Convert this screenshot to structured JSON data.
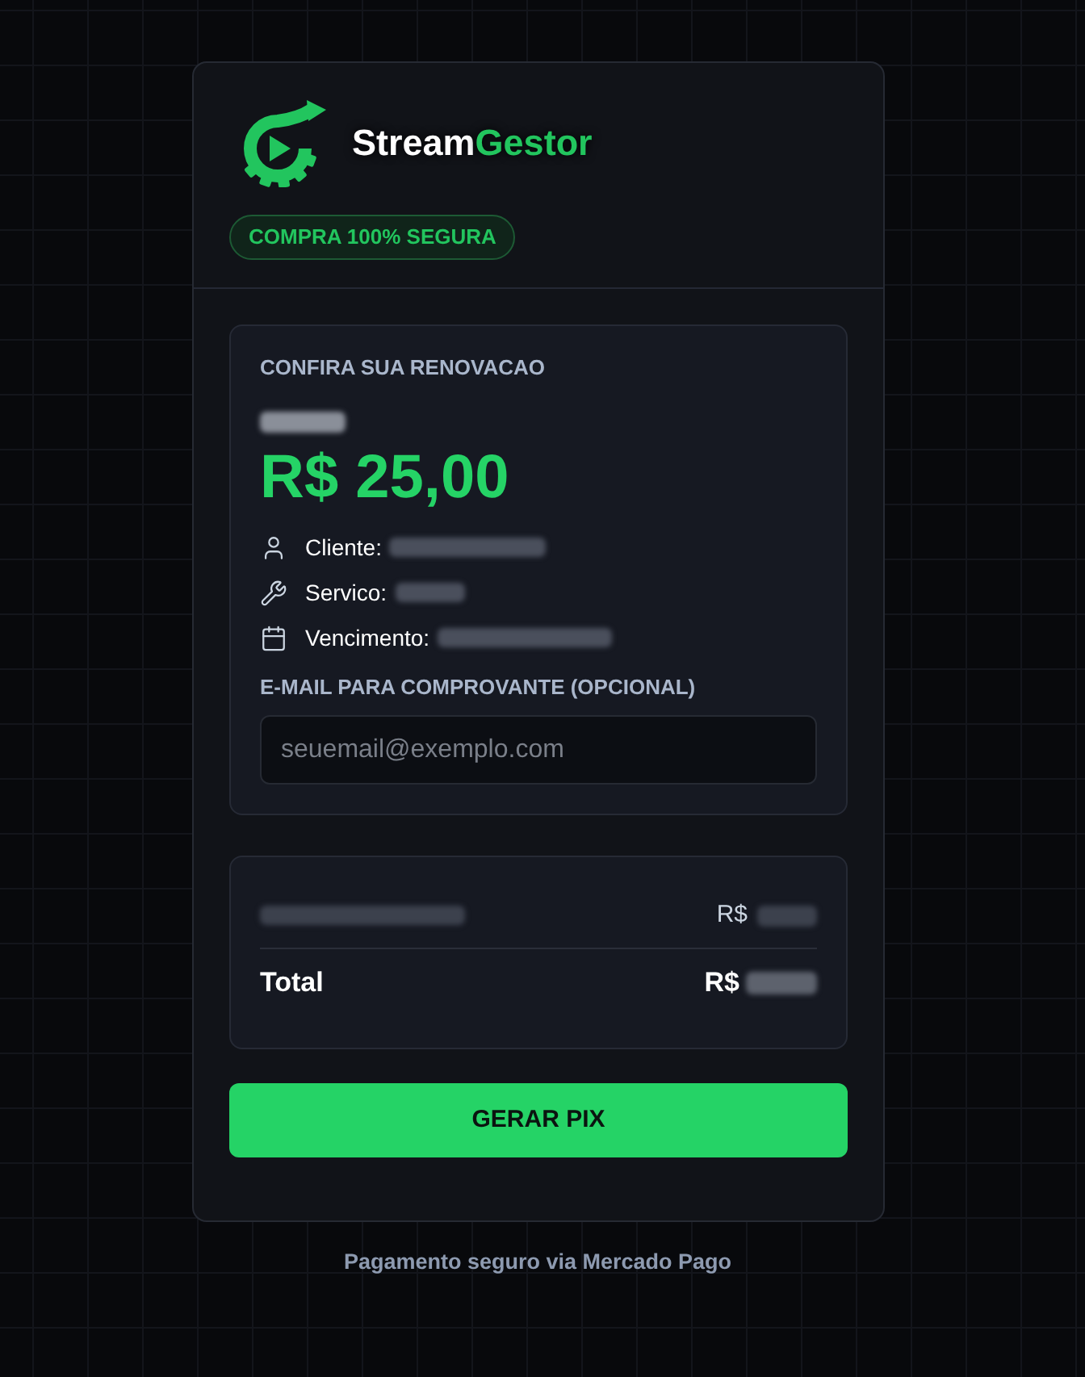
{
  "brand": {
    "name": "Stream",
    "accent": "Gestor"
  },
  "badge": "COMPRA 100% SEGURA",
  "renewal": {
    "heading": "CONFIRA SUA RENOVACAO",
    "product": {
      "redacted": true
    },
    "price": "R$ 25,00",
    "details": [
      {
        "kind": "client",
        "label": "Cliente:",
        "value": {
          "redacted": true
        }
      },
      {
        "kind": "service",
        "label": "Servico:",
        "value": {
          "redacted": true
        }
      },
      {
        "kind": "due",
        "label": "Vencimento:",
        "value": {
          "redacted": true
        }
      }
    ],
    "email": {
      "label": "E-MAIL PARA COMPROVANTE (OPCIONAL)",
      "placeholder": "seuemail@exemplo.com"
    }
  },
  "summary": {
    "items": [
      {
        "description": {
          "redacted": true
        },
        "currency": "R$",
        "amount": {
          "redacted": true
        }
      }
    ],
    "total": {
      "label": "Total",
      "currency": "R$",
      "amount": {
        "redacted": true
      }
    }
  },
  "button": "GERAR PIX",
  "footer": "Pagamento seguro via Mercado Pago"
}
